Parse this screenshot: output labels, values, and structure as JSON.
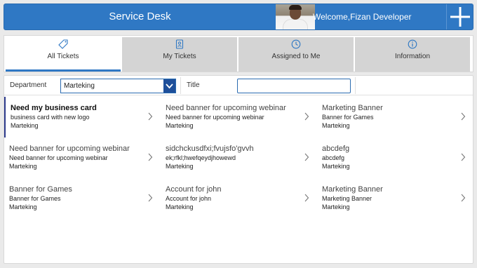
{
  "header": {
    "title": "Service Desk",
    "welcome": "Welcome,Fizan Developer",
    "accent": "#2f78c4"
  },
  "tabs": [
    {
      "label": "All Tickets",
      "icon": "tag-icon",
      "active": true
    },
    {
      "label": "My Tickets",
      "icon": "id-badge-icon",
      "active": false
    },
    {
      "label": "Assigned to Me",
      "icon": "clock-icon",
      "active": false
    },
    {
      "label": "Information",
      "icon": "info-icon",
      "active": false
    }
  ],
  "filters": {
    "department_label": "Department",
    "department_value": "Marteking",
    "title_label": "Title",
    "title_value": ""
  },
  "tickets": [
    {
      "title": "Need my business card",
      "subtitle": "business card with new logo",
      "department": "Marteking",
      "selected": true
    },
    {
      "title": "Need banner for upcoming webinar",
      "subtitle": "Need banner for upcoming webinar",
      "department": "Marteking"
    },
    {
      "title": "Marketing Banner",
      "subtitle": "Banner for Games",
      "department": "Marteking"
    },
    {
      "title": "Need banner for upcoming webinar",
      "subtitle": "Need banner for upcoming webinar",
      "department": "Marteking"
    },
    {
      "title": "sidchckusdfxi;fvujsfo'gvvh",
      "subtitle": "ek;rfkl;hwefqeydjhowewd",
      "department": "Marteking"
    },
    {
      "title": "abcdefg",
      "subtitle": "abcdefg",
      "department": "Marteking"
    },
    {
      "title": "Banner for Games",
      "subtitle": "Banner for Games",
      "department": "Marteking"
    },
    {
      "title": "Account for john",
      "subtitle": "Account for john",
      "department": "Marteking"
    },
    {
      "title": "Marketing Banner",
      "subtitle": "Marketing Banner",
      "department": "Marteking"
    }
  ]
}
